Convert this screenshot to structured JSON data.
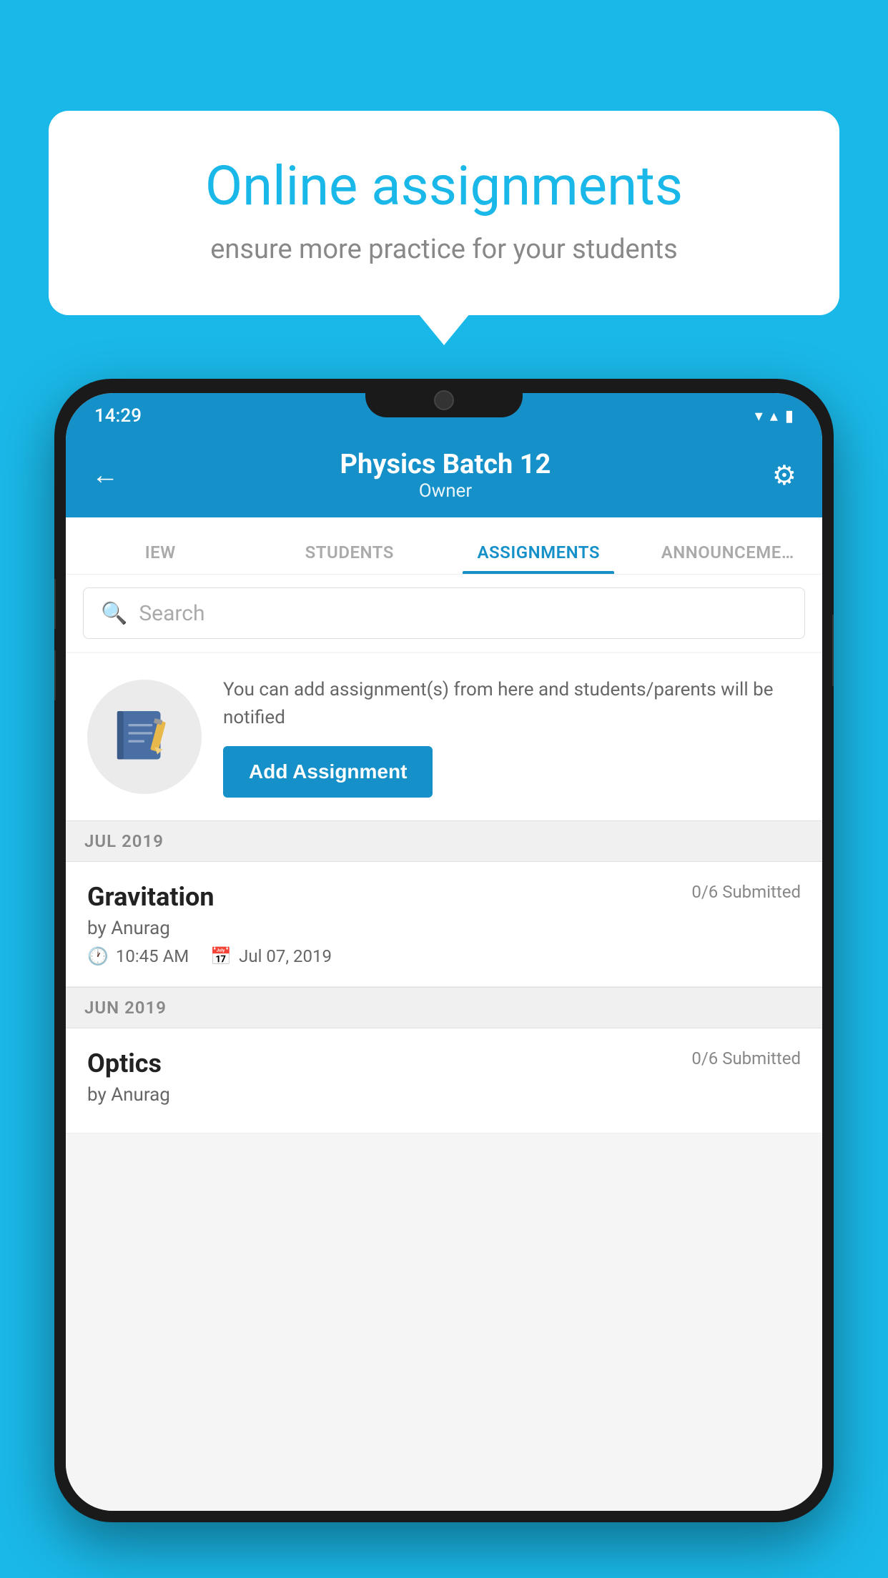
{
  "background": {
    "color": "#1ab8e8"
  },
  "speech_bubble": {
    "title": "Online assignments",
    "subtitle": "ensure more practice for your students"
  },
  "status_bar": {
    "time": "14:29",
    "wifi": "▼",
    "signal": "▲",
    "battery": "■"
  },
  "header": {
    "title": "Physics Batch 12",
    "subtitle": "Owner",
    "back_label": "←",
    "gear_label": "⚙"
  },
  "tabs": [
    {
      "label": "IEW",
      "active": false
    },
    {
      "label": "STUDENTS",
      "active": false
    },
    {
      "label": "ASSIGNMENTS",
      "active": true
    },
    {
      "label": "ANNOUNCEMENTS",
      "active": false
    }
  ],
  "search": {
    "placeholder": "Search"
  },
  "add_assignment_card": {
    "description": "You can add assignment(s) from here and students/parents will be notified",
    "button_label": "Add Assignment"
  },
  "sections": [
    {
      "month": "JUL 2019",
      "assignments": [
        {
          "name": "Gravitation",
          "submitted": "0/6 Submitted",
          "by": "by Anurag",
          "time": "10:45 AM",
          "date": "Jul 07, 2019"
        }
      ]
    },
    {
      "month": "JUN 2019",
      "assignments": [
        {
          "name": "Optics",
          "submitted": "0/6 Submitted",
          "by": "by Anurag",
          "time": "",
          "date": ""
        }
      ]
    }
  ]
}
